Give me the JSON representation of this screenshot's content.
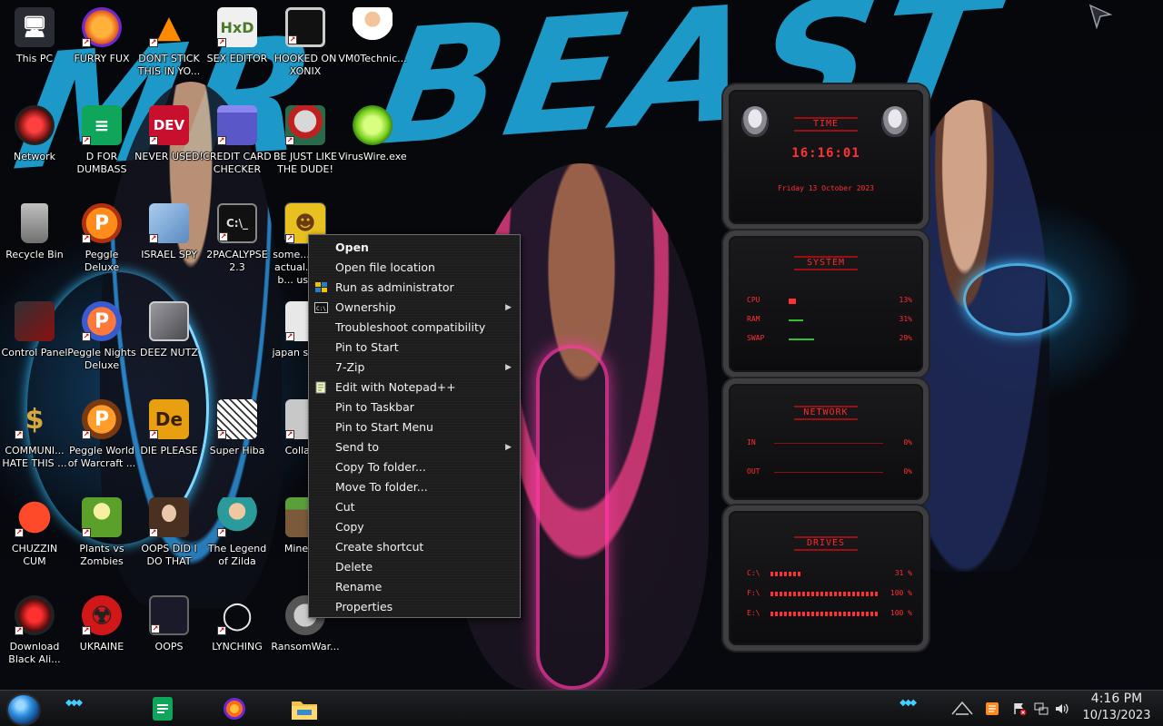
{
  "wallpaper": {
    "title": "MR BEAST"
  },
  "desktop_icons": [
    {
      "label": "This PC",
      "icon": "computer-icon"
    },
    {
      "label": "FURRY FUX",
      "icon": "firefox-icon"
    },
    {
      "label": "DONT STICK THIS IN YO...",
      "icon": "vlc-cone-icon"
    },
    {
      "label": "SEX EDITOR",
      "icon": "hxd-icon"
    },
    {
      "label": "HOOKED ON XONIX",
      "icon": "xonix-game-icon"
    },
    {
      "label": "VM0Technic...",
      "icon": "doctor-icon"
    },
    {
      "label": "Network",
      "icon": "network-icon"
    },
    {
      "label": "D FOR DUMBASS",
      "icon": "google-docs-icon"
    },
    {
      "label": "NEVER USED!",
      "icon": "dev-cpp-icon"
    },
    {
      "label": "CREDIT CARD CHECKER",
      "icon": "credit-card-icon"
    },
    {
      "label": "BE JUST LIKE THE DUDE!",
      "icon": "dude-icon"
    },
    {
      "label": "VirusWire.exe",
      "icon": "lime-icon"
    },
    {
      "label": "Recycle Bin",
      "icon": "recycle-bin-icon"
    },
    {
      "label": "Peggle Deluxe",
      "icon": "peggle-icon"
    },
    {
      "label": "ISRAEL SPY",
      "icon": "network-spy-icon"
    },
    {
      "label": "2PACALYPSE 2.3",
      "icon": "terminal-icon"
    },
    {
      "label": "some... need actual... this b... using...",
      "icon": "beaver-icon"
    },
    {
      "label": "Control Panel",
      "icon": "control-panel-icon"
    },
    {
      "label": "Peggle Nights Deluxe",
      "icon": "peggle-nights-icon"
    },
    {
      "label": "DEEZ NUTZ",
      "icon": "stack-windows-icon"
    },
    {
      "label": "japan s... si...",
      "icon": "japan-icon"
    },
    {
      "label": "COMMUNI... HATE THIS ...",
      "icon": "money-bag-icon"
    },
    {
      "label": "Peggle World of Warcraft ...",
      "icon": "peggle-wow-icon"
    },
    {
      "label": "DIE PLEASE",
      "icon": "de-icon"
    },
    {
      "label": "Super Hiba",
      "icon": "pixel-cat-icon"
    },
    {
      "label": "Collab...",
      "icon": "collab-icon"
    },
    {
      "label": "CHUZZIN CUM",
      "icon": "chuzzle-icon"
    },
    {
      "label": "Plants vs Zombies",
      "icon": "pvz-icon"
    },
    {
      "label": "OOPS DID I DO THAT",
      "icon": "portrait-icon"
    },
    {
      "label": "The Legend of Zilda",
      "icon": "zelda-icon"
    },
    {
      "label": "Minecr...",
      "icon": "minecraft-icon"
    },
    {
      "label": "Download Black Ali...",
      "icon": "alien-icon"
    },
    {
      "label": "UKRAINE",
      "icon": "radiation-icon"
    },
    {
      "label": "OOPS",
      "icon": "book-icon"
    },
    {
      "label": "LYNCHING",
      "icon": "noose-icon"
    },
    {
      "label": "RansomWar...",
      "icon": "ransomware-icon"
    }
  ],
  "context_menu": {
    "items": [
      {
        "label": "Open",
        "bold": true
      },
      {
        "label": "Open file location"
      },
      {
        "label": "Run as administrator",
        "icon": "shield-icon"
      },
      {
        "label": "Ownership",
        "icon": "cmd-icon",
        "submenu": true
      },
      {
        "label": "Troubleshoot compatibility"
      },
      {
        "label": "Pin to Start"
      },
      {
        "label": "7-Zip",
        "submenu": true
      },
      {
        "label": "Edit with Notepad++",
        "icon": "notepad-plus-icon"
      },
      {
        "label": "Pin to Taskbar"
      },
      {
        "label": "Pin to Start Menu"
      },
      {
        "label": "Send to",
        "submenu": true
      },
      {
        "label": "Copy To folder..."
      },
      {
        "label": "Move To folder..."
      },
      {
        "label": "Cut"
      },
      {
        "label": "Copy"
      },
      {
        "label": "Create shortcut"
      },
      {
        "label": "Delete"
      },
      {
        "label": "Rename"
      },
      {
        "label": "Properties"
      }
    ]
  },
  "gadgets": {
    "time": {
      "title": "TIME",
      "value": "16:16:01",
      "date": "Friday 13 October 2023"
    },
    "system": {
      "title": "SYSTEM",
      "rows": [
        {
          "label": "CPU",
          "value": "13%"
        },
        {
          "label": "RAM",
          "value": "31%"
        },
        {
          "label": "SWAP",
          "value": "29%"
        }
      ]
    },
    "network": {
      "title": "NETWORK",
      "rows": [
        {
          "label": "IN",
          "value": "0%"
        },
        {
          "label": "OUT",
          "value": "0%"
        }
      ]
    },
    "drives": {
      "title": "DRIVES",
      "rows": [
        {
          "label": "C:\\",
          "value": "31 %"
        },
        {
          "label": "F:\\",
          "value": "100 %"
        },
        {
          "label": "E:\\",
          "value": "100 %"
        }
      ]
    }
  },
  "taskbar": {
    "apps": [
      {
        "name": "google-docs-icon"
      },
      {
        "name": "firefox-icon"
      },
      {
        "name": "file-explorer-icon"
      }
    ],
    "clock": {
      "time": "4:16 PM",
      "date": "10/13/2023"
    }
  },
  "colors": {
    "accent_blue": "#1fa6d8",
    "gadget_red": "#ff2a2a",
    "menu_bg": "#1d1d1d"
  }
}
